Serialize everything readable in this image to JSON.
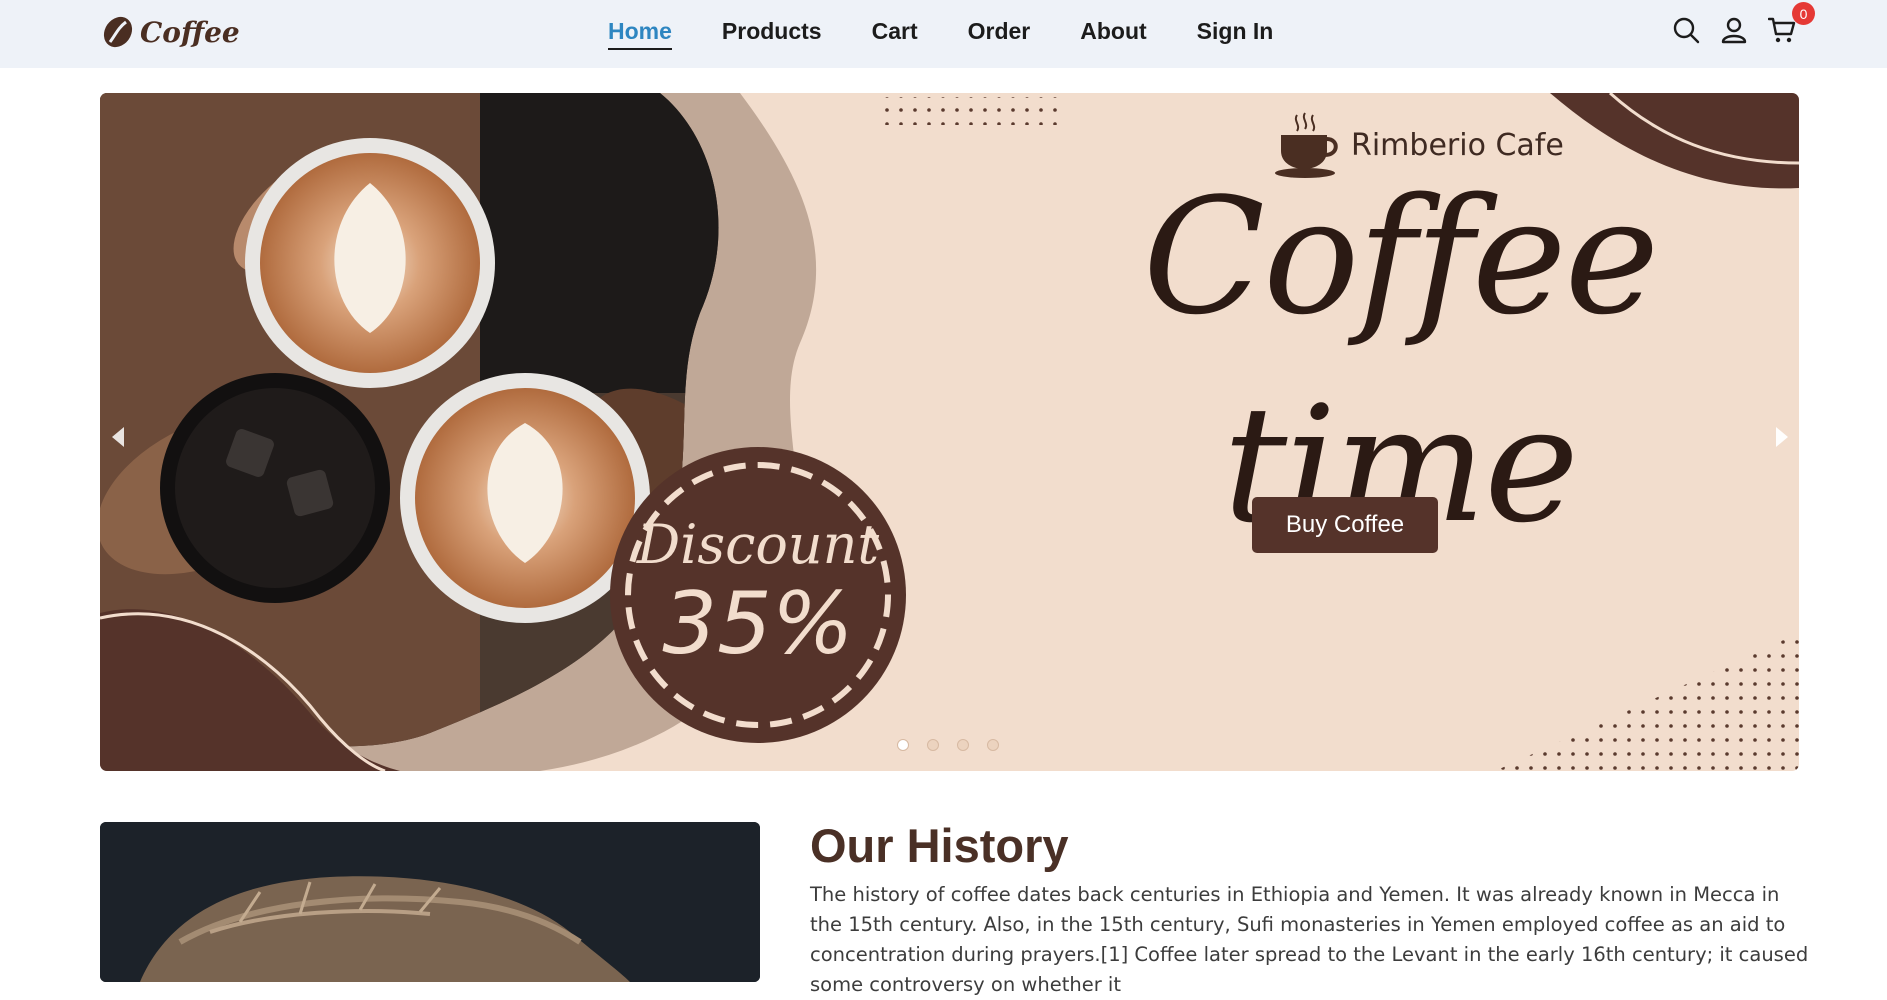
{
  "brand": {
    "logo_text": "Coffee"
  },
  "nav": {
    "links": [
      {
        "label": "Home",
        "active": true
      },
      {
        "label": "Products",
        "active": false
      },
      {
        "label": "Cart",
        "active": false
      },
      {
        "label": "Order",
        "active": false
      },
      {
        "label": "About",
        "active": false
      },
      {
        "label": "Sign In",
        "active": false
      }
    ],
    "icons": [
      "search-icon",
      "user-icon",
      "cart-icon"
    ],
    "cart_count": "0"
  },
  "hero": {
    "brand_name": "Rimberio Cafe",
    "title": "Coffee time",
    "discount_label": "Discount",
    "discount_value": "35%",
    "button_label": "Buy Coffee",
    "slide_count": 4,
    "active_slide": 1
  },
  "history": {
    "title": "Our History",
    "text": "The history of coffee dates back centuries in Ethiopia and Yemen. It was already known in Mecca in the 15th century. Also, in the 15th century, Sufi monasteries in Yemen employed coffee as an aid to concentration during prayers.[1] Coffee later spread to the Levant in the early 16th century; it caused some controversy on whether it"
  },
  "colors": {
    "nav_bg": "#eef2f8",
    "active_link": "#2e86c1",
    "brown_dark": "#55332a",
    "cream": "#f2ddcd",
    "badge": "#e53935"
  }
}
